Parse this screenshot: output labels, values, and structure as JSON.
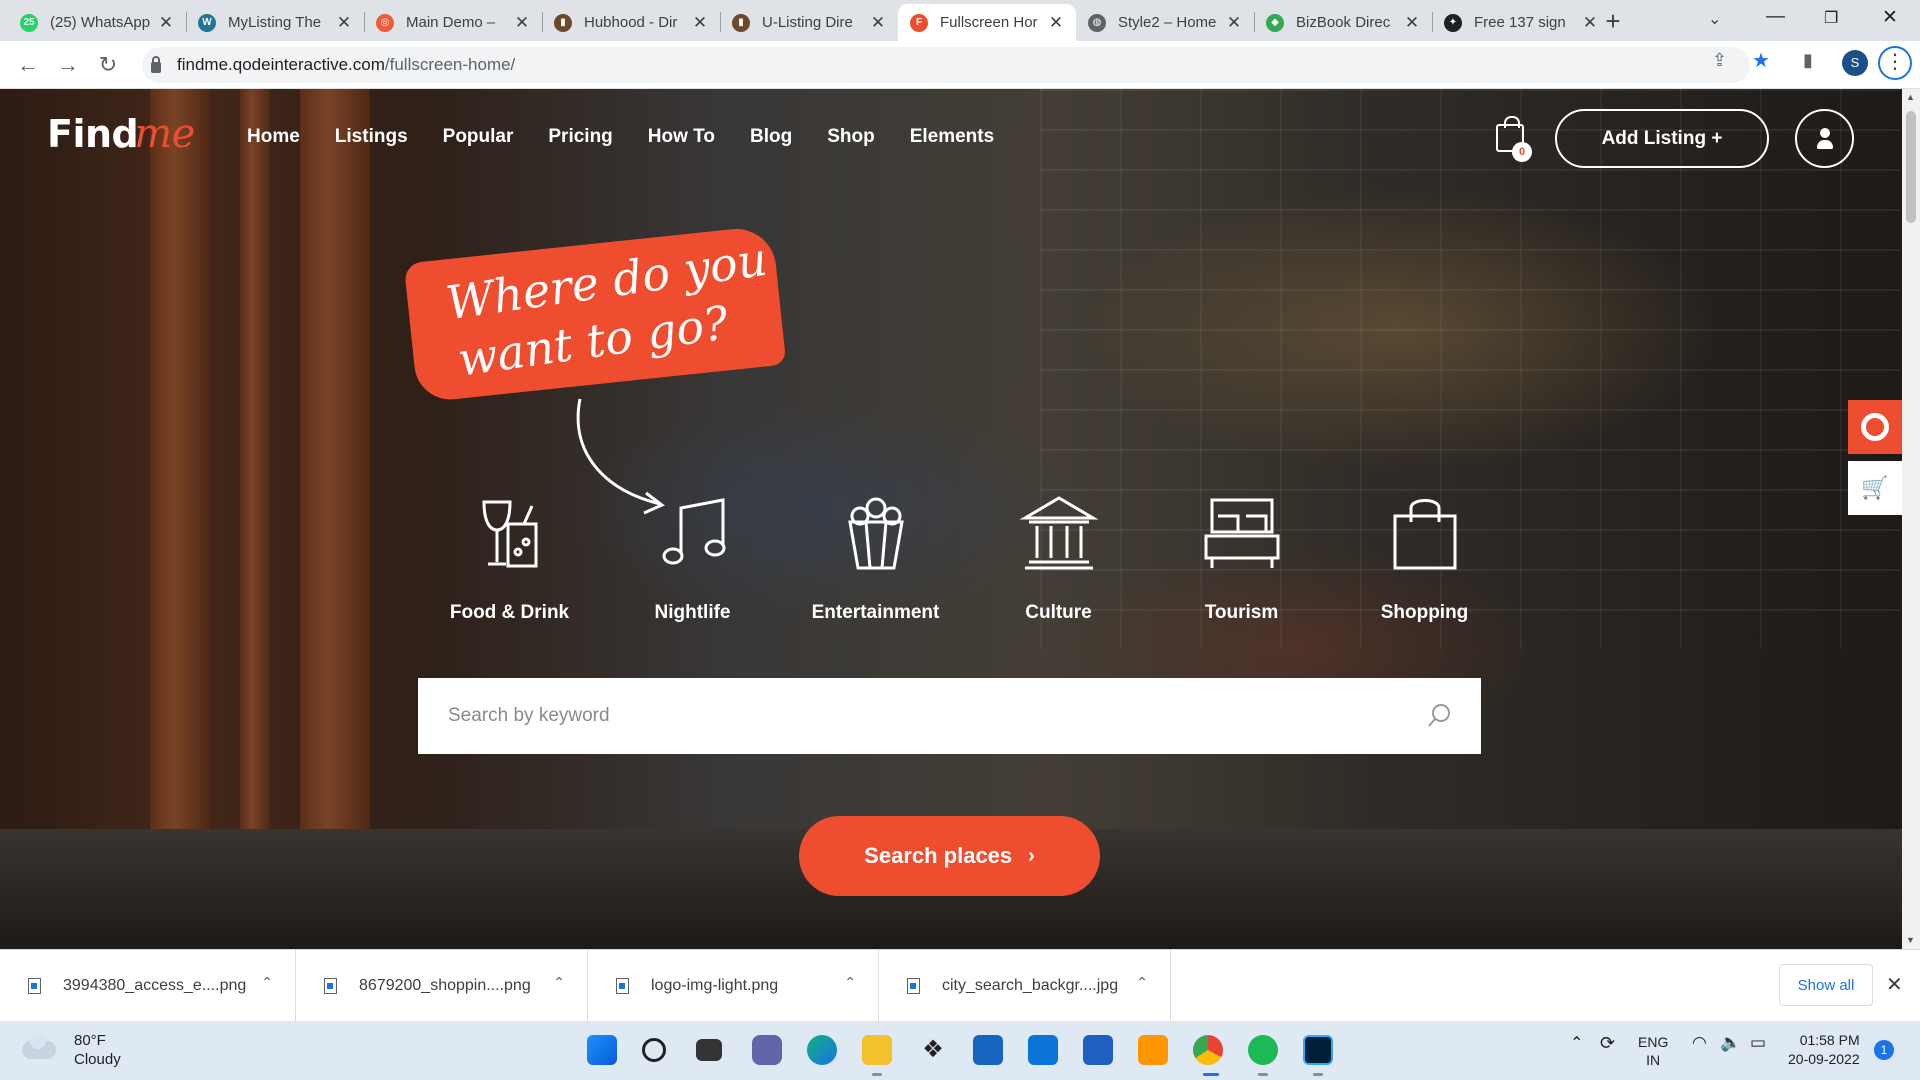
{
  "browser": {
    "tabs": [
      {
        "title": "(25) WhatsApp",
        "favicon_color": "#25d366",
        "favicon_glyph": "25",
        "active": false
      },
      {
        "title": "MyListing The",
        "favicon_color": "#21759b",
        "favicon_glyph": "W",
        "active": false
      },
      {
        "title": "Main Demo –",
        "favicon_color": "#ef5b3b",
        "favicon_glyph": "◎",
        "active": false
      },
      {
        "title": "Hubhood - Dir",
        "favicon_color": "#6b4a2b",
        "favicon_glyph": "▮",
        "active": false
      },
      {
        "title": "U-Listing Dire",
        "favicon_color": "#6b4a2b",
        "favicon_glyph": "▮",
        "active": false
      },
      {
        "title": "Fullscreen Hor",
        "favicon_color": "#ef4d2f",
        "favicon_glyph": "F",
        "active": true
      },
      {
        "title": "Style2 – Home",
        "favicon_color": "#5f6368",
        "favicon_glyph": "◍",
        "active": false
      },
      {
        "title": "BizBook Direc",
        "favicon_color": "#34a853",
        "favicon_glyph": "◆",
        "active": false
      },
      {
        "title": "Free 137 sign",
        "favicon_color": "#202124",
        "favicon_glyph": "✦",
        "active": false
      }
    ],
    "new_tab_glyph": "+",
    "url_host": "findme.qodeinteractive.com",
    "url_path": "/fullscreen-home/",
    "profile_initial": "S"
  },
  "site": {
    "logo_main": "Find",
    "logo_script": "me",
    "nav": [
      "Home",
      "Listings",
      "Popular",
      "Pricing",
      "How To",
      "Blog",
      "Shop",
      "Elements"
    ],
    "cart_count": "0",
    "add_listing_label": "Add Listing +",
    "tagline_line1": "Where do you",
    "tagline_line2": "want to go?",
    "categories": [
      {
        "label": "Food & Drink",
        "icon": "drinks-icon"
      },
      {
        "label": "Nightlife",
        "icon": "music-note-icon"
      },
      {
        "label": "Entertainment",
        "icon": "popcorn-icon"
      },
      {
        "label": "Culture",
        "icon": "museum-icon"
      },
      {
        "label": "Tourism",
        "icon": "bed-icon"
      },
      {
        "label": "Shopping",
        "icon": "shopping-bag-icon"
      }
    ],
    "search_placeholder": "Search by keyword",
    "search_button_label": "Search places",
    "accent_color": "#ef4d2f"
  },
  "downloads": {
    "items": [
      "3994380_access_e....png",
      "8679200_shoppin....png",
      "logo-img-light.png",
      "city_search_backgr....jpg"
    ],
    "show_all_label": "Show all"
  },
  "taskbar": {
    "weather_temp": "80°F",
    "weather_desc": "Cloudy",
    "lang_top": "ENG",
    "lang_bottom": "IN",
    "time": "01:58 PM",
    "date": "20-09-2022",
    "notification_count": "1"
  }
}
